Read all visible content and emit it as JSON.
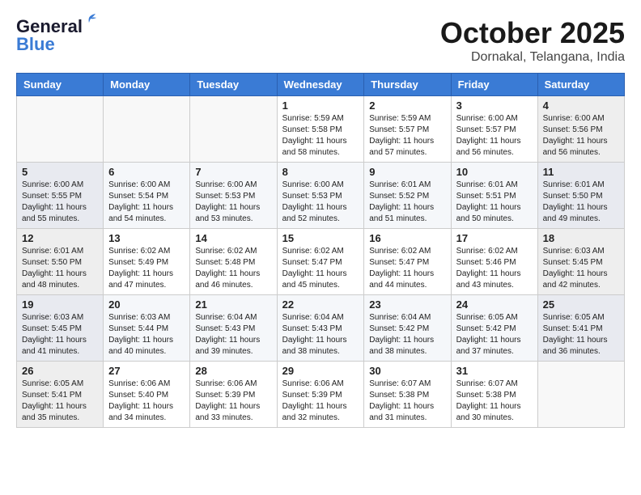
{
  "header": {
    "logo_general": "General",
    "logo_blue": "Blue",
    "month_year": "October 2025",
    "location": "Dornakal, Telangana, India"
  },
  "days_of_week": [
    "Sunday",
    "Monday",
    "Tuesday",
    "Wednesday",
    "Thursday",
    "Friday",
    "Saturday"
  ],
  "weeks": [
    {
      "days": [
        {
          "num": "",
          "info": ""
        },
        {
          "num": "",
          "info": ""
        },
        {
          "num": "",
          "info": ""
        },
        {
          "num": "1",
          "info": "Sunrise: 5:59 AM\nSunset: 5:58 PM\nDaylight: 11 hours\nand 58 minutes."
        },
        {
          "num": "2",
          "info": "Sunrise: 5:59 AM\nSunset: 5:57 PM\nDaylight: 11 hours\nand 57 minutes."
        },
        {
          "num": "3",
          "info": "Sunrise: 6:00 AM\nSunset: 5:57 PM\nDaylight: 11 hours\nand 56 minutes."
        },
        {
          "num": "4",
          "info": "Sunrise: 6:00 AM\nSunset: 5:56 PM\nDaylight: 11 hours\nand 56 minutes."
        }
      ]
    },
    {
      "days": [
        {
          "num": "5",
          "info": "Sunrise: 6:00 AM\nSunset: 5:55 PM\nDaylight: 11 hours\nand 55 minutes."
        },
        {
          "num": "6",
          "info": "Sunrise: 6:00 AM\nSunset: 5:54 PM\nDaylight: 11 hours\nand 54 minutes."
        },
        {
          "num": "7",
          "info": "Sunrise: 6:00 AM\nSunset: 5:53 PM\nDaylight: 11 hours\nand 53 minutes."
        },
        {
          "num": "8",
          "info": "Sunrise: 6:00 AM\nSunset: 5:53 PM\nDaylight: 11 hours\nand 52 minutes."
        },
        {
          "num": "9",
          "info": "Sunrise: 6:01 AM\nSunset: 5:52 PM\nDaylight: 11 hours\nand 51 minutes."
        },
        {
          "num": "10",
          "info": "Sunrise: 6:01 AM\nSunset: 5:51 PM\nDaylight: 11 hours\nand 50 minutes."
        },
        {
          "num": "11",
          "info": "Sunrise: 6:01 AM\nSunset: 5:50 PM\nDaylight: 11 hours\nand 49 minutes."
        }
      ]
    },
    {
      "days": [
        {
          "num": "12",
          "info": "Sunrise: 6:01 AM\nSunset: 5:50 PM\nDaylight: 11 hours\nand 48 minutes."
        },
        {
          "num": "13",
          "info": "Sunrise: 6:02 AM\nSunset: 5:49 PM\nDaylight: 11 hours\nand 47 minutes."
        },
        {
          "num": "14",
          "info": "Sunrise: 6:02 AM\nSunset: 5:48 PM\nDaylight: 11 hours\nand 46 minutes."
        },
        {
          "num": "15",
          "info": "Sunrise: 6:02 AM\nSunset: 5:47 PM\nDaylight: 11 hours\nand 45 minutes."
        },
        {
          "num": "16",
          "info": "Sunrise: 6:02 AM\nSunset: 5:47 PM\nDaylight: 11 hours\nand 44 minutes."
        },
        {
          "num": "17",
          "info": "Sunrise: 6:02 AM\nSunset: 5:46 PM\nDaylight: 11 hours\nand 43 minutes."
        },
        {
          "num": "18",
          "info": "Sunrise: 6:03 AM\nSunset: 5:45 PM\nDaylight: 11 hours\nand 42 minutes."
        }
      ]
    },
    {
      "days": [
        {
          "num": "19",
          "info": "Sunrise: 6:03 AM\nSunset: 5:45 PM\nDaylight: 11 hours\nand 41 minutes."
        },
        {
          "num": "20",
          "info": "Sunrise: 6:03 AM\nSunset: 5:44 PM\nDaylight: 11 hours\nand 40 minutes."
        },
        {
          "num": "21",
          "info": "Sunrise: 6:04 AM\nSunset: 5:43 PM\nDaylight: 11 hours\nand 39 minutes."
        },
        {
          "num": "22",
          "info": "Sunrise: 6:04 AM\nSunset: 5:43 PM\nDaylight: 11 hours\nand 38 minutes."
        },
        {
          "num": "23",
          "info": "Sunrise: 6:04 AM\nSunset: 5:42 PM\nDaylight: 11 hours\nand 38 minutes."
        },
        {
          "num": "24",
          "info": "Sunrise: 6:05 AM\nSunset: 5:42 PM\nDaylight: 11 hours\nand 37 minutes."
        },
        {
          "num": "25",
          "info": "Sunrise: 6:05 AM\nSunset: 5:41 PM\nDaylight: 11 hours\nand 36 minutes."
        }
      ]
    },
    {
      "days": [
        {
          "num": "26",
          "info": "Sunrise: 6:05 AM\nSunset: 5:41 PM\nDaylight: 11 hours\nand 35 minutes."
        },
        {
          "num": "27",
          "info": "Sunrise: 6:06 AM\nSunset: 5:40 PM\nDaylight: 11 hours\nand 34 minutes."
        },
        {
          "num": "28",
          "info": "Sunrise: 6:06 AM\nSunset: 5:39 PM\nDaylight: 11 hours\nand 33 minutes."
        },
        {
          "num": "29",
          "info": "Sunrise: 6:06 AM\nSunset: 5:39 PM\nDaylight: 11 hours\nand 32 minutes."
        },
        {
          "num": "30",
          "info": "Sunrise: 6:07 AM\nSunset: 5:38 PM\nDaylight: 11 hours\nand 31 minutes."
        },
        {
          "num": "31",
          "info": "Sunrise: 6:07 AM\nSunset: 5:38 PM\nDaylight: 11 hours\nand 30 minutes."
        },
        {
          "num": "",
          "info": ""
        }
      ]
    }
  ]
}
